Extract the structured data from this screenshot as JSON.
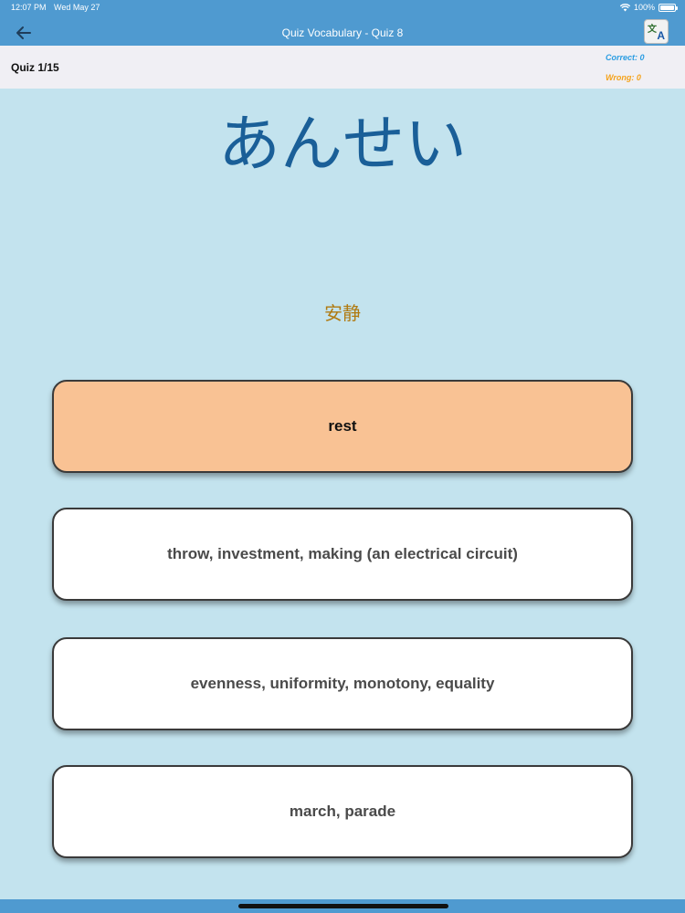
{
  "status": {
    "time": "12:07 PM",
    "date": "Wed May 27",
    "battery": "100%"
  },
  "nav": {
    "title": "Quiz Vocabulary - Quiz 8",
    "translate_glyph_1": "文",
    "translate_glyph_2": "A"
  },
  "info": {
    "progress": "Quiz 1/15",
    "correct": "Correct: 0",
    "wrong": "Wrong: 0"
  },
  "question": {
    "kana": "あんせい",
    "kanji": "安静"
  },
  "answers": [
    {
      "label": "rest",
      "selected": true
    },
    {
      "label": "throw, investment, making (an electrical circuit)",
      "selected": false
    },
    {
      "label": "evenness, uniformity, monotony, equality",
      "selected": false
    },
    {
      "label": "march, parade",
      "selected": false
    }
  ],
  "colors": {
    "nav_blue": "#4f9ad0",
    "background": "#c3e3ee",
    "kana_blue": "#1a5f98",
    "kanji_gold": "#b07a10",
    "selected_answer": "#f9c294",
    "correct_blue": "#2b9de2",
    "wrong_orange": "#f5a31c"
  }
}
